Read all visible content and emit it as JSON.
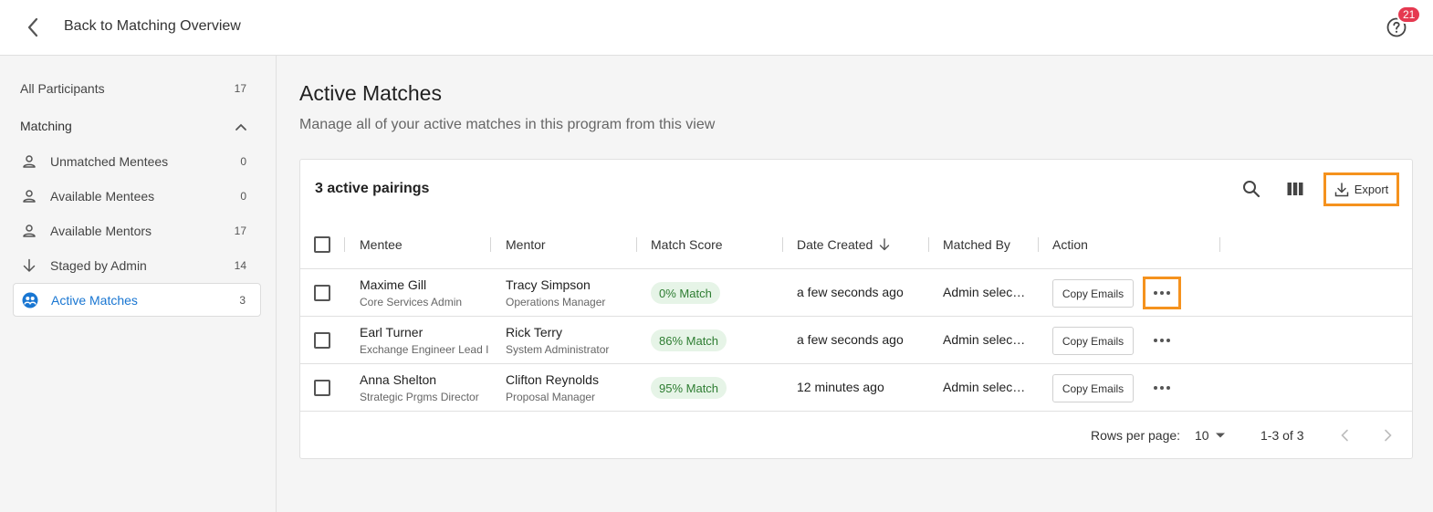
{
  "header": {
    "back_label": "Back to Matching Overview",
    "notification_count": "21"
  },
  "sidebar": {
    "all_participants": {
      "label": "All Participants",
      "count": "17"
    },
    "section_label": "Matching",
    "items": [
      {
        "label": "Unmatched Mentees",
        "count": "0",
        "icon": "person-icon"
      },
      {
        "label": "Available Mentees",
        "count": "0",
        "icon": "person-icon"
      },
      {
        "label": "Available Mentors",
        "count": "17",
        "icon": "person-icon"
      },
      {
        "label": "Staged by Admin",
        "count": "14",
        "icon": "arrow-down-icon"
      },
      {
        "label": "Active Matches",
        "count": "3",
        "icon": "matches-icon",
        "active": true
      }
    ]
  },
  "main": {
    "title": "Active Matches",
    "subtitle": "Manage all of your active matches in this program from this view"
  },
  "table": {
    "title": "3 active pairings",
    "export_label": "Export",
    "columns": {
      "mentee": "Mentee",
      "mentor": "Mentor",
      "match_score": "Match Score",
      "date_created": "Date Created",
      "matched_by": "Matched By",
      "action": "Action"
    },
    "rows": [
      {
        "mentee_name": "Maxime Gill",
        "mentee_title": "Core Services Admin",
        "mentor_name": "Tracy Simpson",
        "mentor_title": "Operations Manager",
        "score": "0% Match",
        "date": "a few seconds ago",
        "matched_by": "Admin selec…",
        "action_label": "Copy Emails"
      },
      {
        "mentee_name": "Earl Turner",
        "mentee_title": "Exchange Engineer Lead I",
        "mentor_name": "Rick Terry",
        "mentor_title": "System Administrator",
        "score": "86% Match",
        "date": "a few seconds ago",
        "matched_by": "Admin selec…",
        "action_label": "Copy Emails"
      },
      {
        "mentee_name": "Anna Shelton",
        "mentee_title": "Strategic Prgms Director",
        "mentor_name": "Clifton Reynolds",
        "mentor_title": "Proposal Manager",
        "score": "95% Match",
        "date": "12 minutes ago",
        "matched_by": "Admin selec…",
        "action_label": "Copy Emails"
      }
    ],
    "footer": {
      "rows_per_page_label": "Rows per page:",
      "rows_per_page": "10",
      "range": "1-3 of 3"
    }
  },
  "colors": {
    "accent": "#1976d2",
    "highlight": "#f5921e",
    "badge": "#e53950",
    "pill_bg": "#e6f4e7",
    "pill_text": "#2e7d32"
  }
}
